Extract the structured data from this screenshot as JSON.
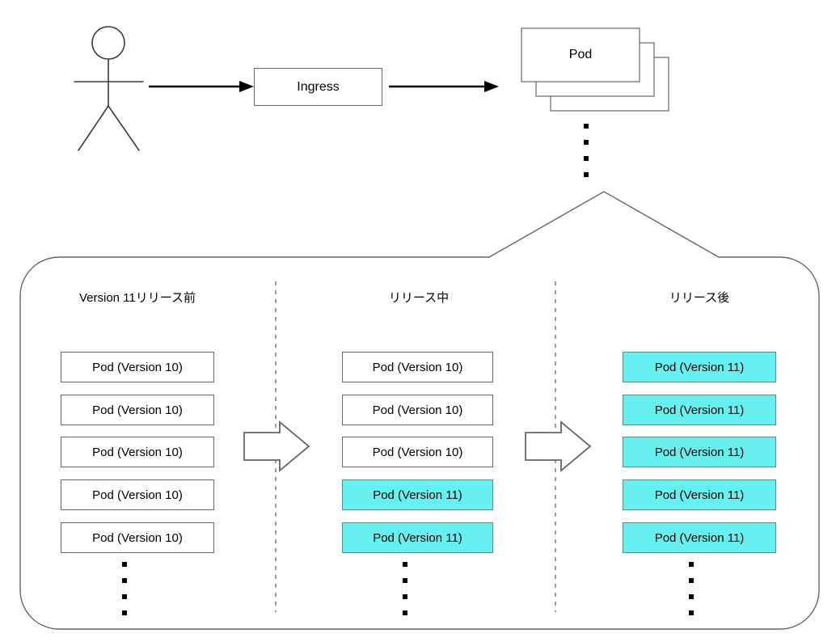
{
  "diagram": {
    "title_elements": {
      "actor_name": "actor",
      "ingress_label": "Ingress",
      "pod_stack_label": "Pod"
    },
    "columns": [
      {
        "header": "Version 11リリース前",
        "pods": [
          {
            "label": "Pod (Version 10)",
            "version": 10,
            "highlighted": false
          },
          {
            "label": "Pod (Version 10)",
            "version": 10,
            "highlighted": false
          },
          {
            "label": "Pod (Version 10)",
            "version": 10,
            "highlighted": false
          },
          {
            "label": "Pod (Version 10)",
            "version": 10,
            "highlighted": false
          },
          {
            "label": "Pod (Version 10)",
            "version": 10,
            "highlighted": false
          }
        ],
        "ellipsis_dots": 4
      },
      {
        "header": "リリース中",
        "pods": [
          {
            "label": "Pod (Version 10)",
            "version": 10,
            "highlighted": false
          },
          {
            "label": "Pod (Version 10)",
            "version": 10,
            "highlighted": false
          },
          {
            "label": "Pod (Version 10)",
            "version": 10,
            "highlighted": false
          },
          {
            "label": "Pod (Version 11)",
            "version": 11,
            "highlighted": true
          },
          {
            "label": "Pod (Version 11)",
            "version": 11,
            "highlighted": true
          }
        ],
        "ellipsis_dots": 4
      },
      {
        "header": "リリース後",
        "pods": [
          {
            "label": "Pod (Version 11)",
            "version": 11,
            "highlighted": true
          },
          {
            "label": "Pod (Version 11)",
            "version": 11,
            "highlighted": true
          },
          {
            "label": "Pod (Version 11)",
            "version": 11,
            "highlighted": true
          },
          {
            "label": "Pod (Version 11)",
            "version": 11,
            "highlighted": true
          },
          {
            "label": "Pod (Version 11)",
            "version": 11,
            "highlighted": true
          }
        ],
        "ellipsis_dots": 4
      }
    ],
    "pod_stack_ellipsis_dots": 4,
    "pod_stack_count": 3,
    "colors": {
      "highlight_fill": "#66f0f0",
      "line": "#666666",
      "arrow_solid": "#000000",
      "text": "#000000",
      "background": "#ffffff"
    }
  }
}
